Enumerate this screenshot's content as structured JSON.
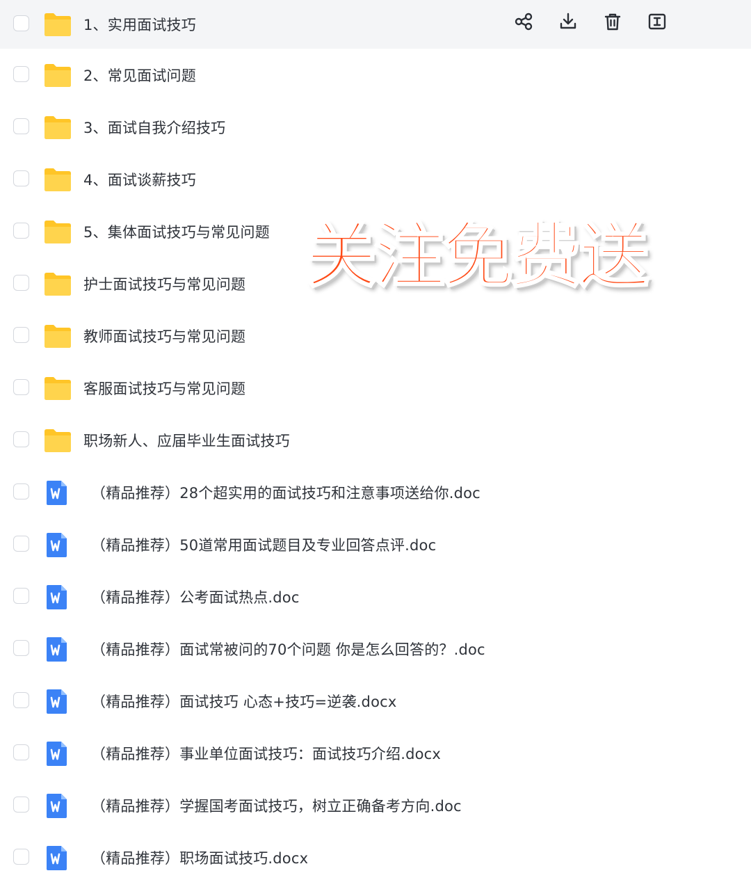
{
  "toolbar": {
    "actions": [
      {
        "name": "share-icon"
      },
      {
        "name": "download-icon"
      },
      {
        "name": "delete-icon"
      },
      {
        "name": "rename-icon"
      }
    ]
  },
  "colors": {
    "folder": "#ffc527",
    "word": "#3b82f6",
    "promo": "#ff4a16",
    "hover_row": "#f4f5f7"
  },
  "items": [
    {
      "type": "folder",
      "name": "1、实用面试技巧"
    },
    {
      "type": "folder",
      "name": "2、常见面试问题"
    },
    {
      "type": "folder",
      "name": "3、面试自我介绍技巧"
    },
    {
      "type": "folder",
      "name": "4、面试谈薪技巧"
    },
    {
      "type": "folder",
      "name": "5、集体面试技巧与常见问题"
    },
    {
      "type": "folder",
      "name": "护士面试技巧与常见问题"
    },
    {
      "type": "folder",
      "name": "教师面试技巧与常见问题"
    },
    {
      "type": "folder",
      "name": "客服面试技巧与常见问题"
    },
    {
      "type": "folder",
      "name": "职场新人、应届毕业生面试技巧"
    },
    {
      "type": "doc",
      "name": "（精品推荐）28个超实用的面试技巧和注意事项送给你.doc"
    },
    {
      "type": "doc",
      "name": "（精品推荐）50道常用面试题目及专业回答点评.doc"
    },
    {
      "type": "doc",
      "name": "（精品推荐）公考面试热点.doc"
    },
    {
      "type": "doc",
      "name": "（精品推荐）面试常被问的70个问题 你是怎么回答的？.doc"
    },
    {
      "type": "doc",
      "name": "（精品推荐）面试技巧 心态+技巧=逆袭.docx"
    },
    {
      "type": "doc",
      "name": "（精品推荐）事业单位面试技巧：面试技巧介绍.docx"
    },
    {
      "type": "doc",
      "name": "（精品推荐）学握国考面试技巧，树立正确备考方向.doc"
    },
    {
      "type": "doc",
      "name": "（精品推荐）职场面试技巧.docx"
    }
  ],
  "promo": {
    "text": "关注免费送"
  }
}
